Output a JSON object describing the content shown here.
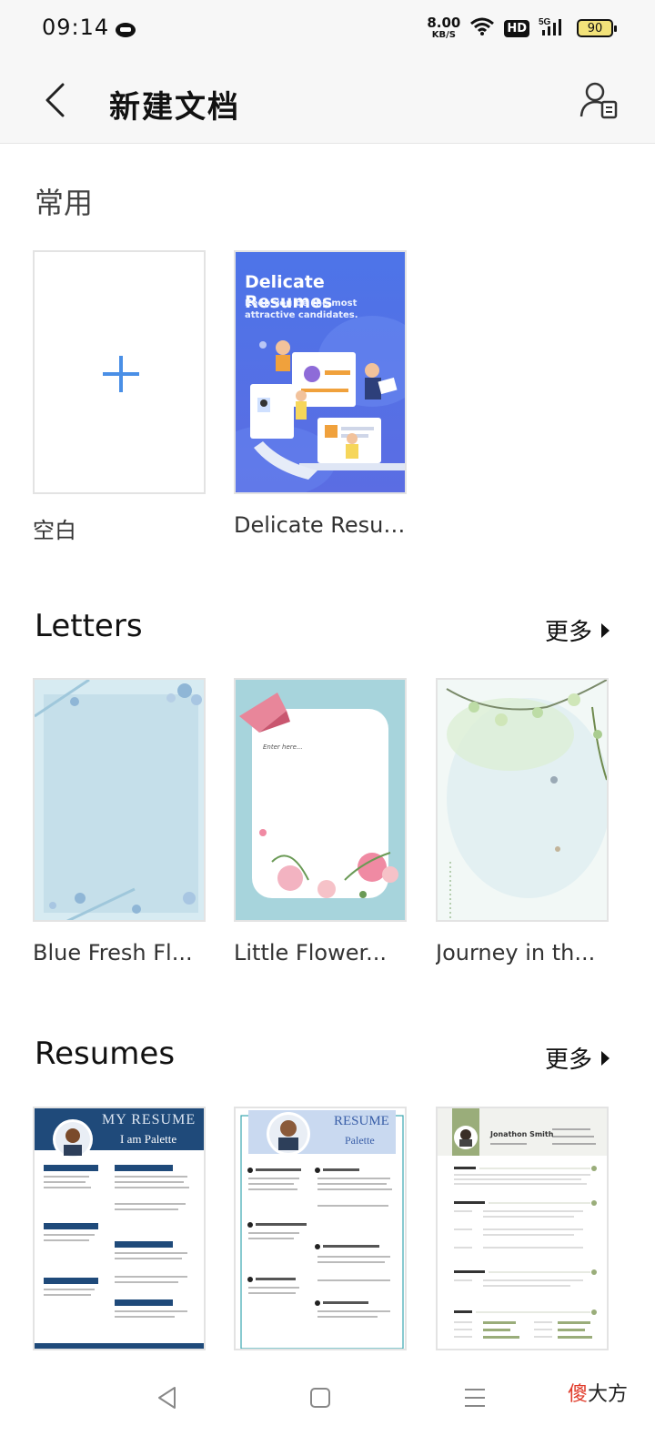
{
  "status_bar": {
    "time": "09:14",
    "net_speed_value": "8.00",
    "net_speed_unit": "KB/S",
    "hd_label": "HD",
    "network_label": "5G",
    "battery_level": "90"
  },
  "header": {
    "title": "新建文档"
  },
  "sections": {
    "common": {
      "title": "常用",
      "items": [
        {
          "label": "空白"
        },
        {
          "label": "Delicate Resum...",
          "cover_title": "Delicate Resumes",
          "cover_subtitle": "Keep you be the most attractive candidates."
        }
      ]
    },
    "letters": {
      "title": "Letters",
      "more_label": "更多",
      "items": [
        {
          "label": "Blue Fresh Fl..."
        },
        {
          "label": "Little Flower...",
          "inner_text": "Enter here..."
        },
        {
          "label": "Journey in th..."
        }
      ]
    },
    "resumes": {
      "title": "Resumes",
      "more_label": "更多",
      "items": [
        {
          "heading": "MY RESUME",
          "subheading": "I am Palette"
        },
        {
          "heading": "RESUME",
          "subheading": "Palette"
        },
        {
          "heading": "Jonathon Smith"
        }
      ]
    }
  },
  "watermark": {
    "highlight": "傻",
    "rest": "大方"
  },
  "colors": {
    "accent": "#4a8fe6",
    "resume_navy": "#1f4a7a",
    "resume_cover_blue": "#4d74e8"
  }
}
